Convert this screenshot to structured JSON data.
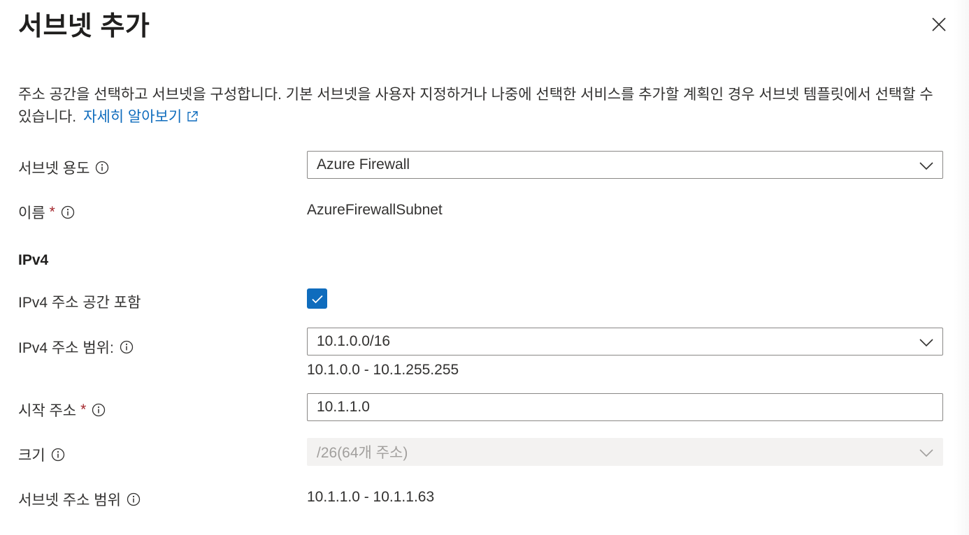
{
  "header": {
    "title": "서브넷 추가"
  },
  "description": {
    "text": "주소 공간을 선택하고 서브넷을 구성합니다. 기본 서브넷을 사용자 지정하거나 나중에 선택한 서비스를 추가할 계획인 경우 서브넷 템플릿에서 선택할 수 있습니다.",
    "link_label": "자세히 알아보기"
  },
  "form": {
    "purpose": {
      "label": "서브넷 용도",
      "value": "Azure Firewall"
    },
    "name": {
      "label": "이름",
      "required_mark": "*",
      "value": "AzureFirewallSubnet"
    },
    "ipv4_section": {
      "title": "IPv4"
    },
    "include_ipv4": {
      "label": "IPv4 주소 공간 포함",
      "checked": true
    },
    "ipv4_range": {
      "label": "IPv4 주소 범위:",
      "value": "10.1.0.0/16",
      "range_text": "10.1.0.0 - 10.1.255.255"
    },
    "start_address": {
      "label": "시작 주소",
      "required_mark": "*",
      "value": "10.1.1.0"
    },
    "size": {
      "label": "크기",
      "value": "/26(64개 주소)"
    },
    "subnet_range": {
      "label": "서브넷 주소 범위",
      "value": "10.1.1.0 - 10.1.1.63"
    }
  },
  "colors": {
    "accent": "#0f6cbd",
    "required": "#a4262c",
    "text": "#323130",
    "disabled_bg": "#f3f2f1"
  }
}
